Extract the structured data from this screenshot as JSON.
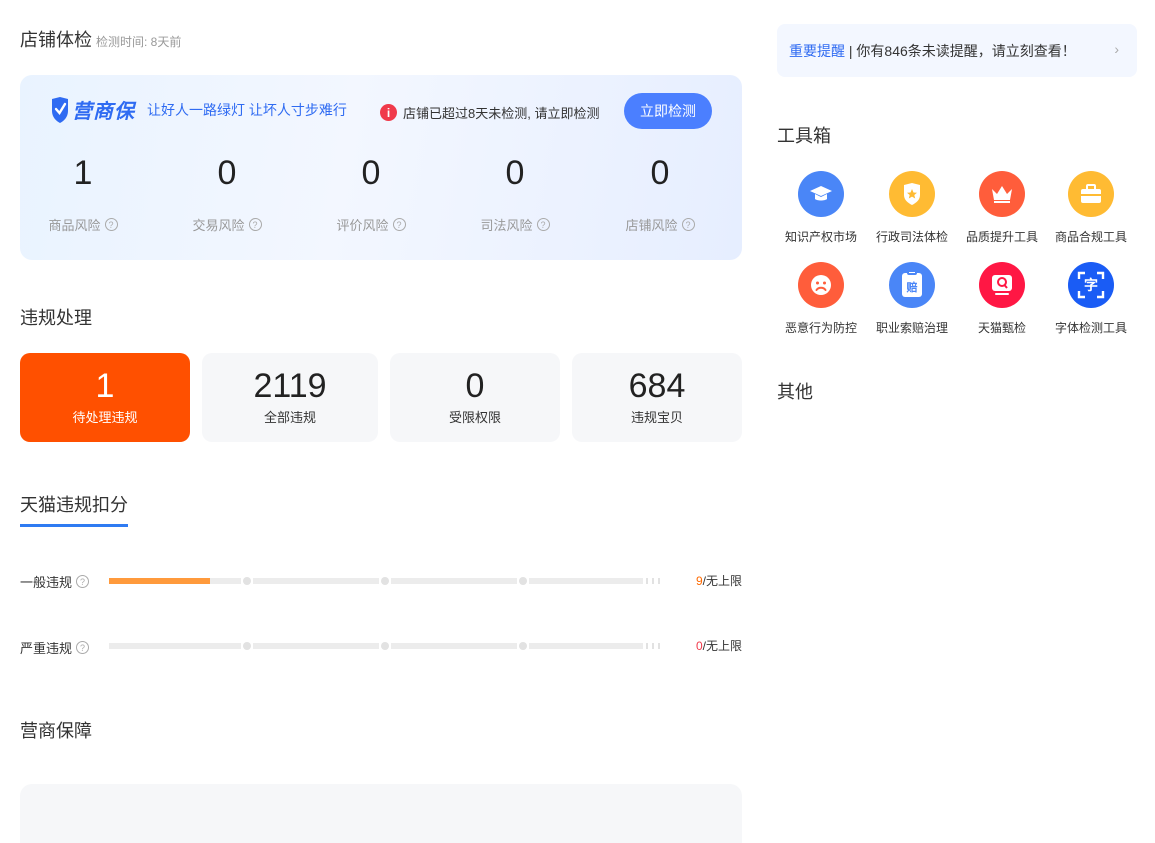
{
  "health": {
    "title": "店铺体检",
    "check_time": "检测时间: 8天前",
    "brand_name": "营商保",
    "slogan": "让好人一路绿灯 让坏人寸步难行",
    "warning": "店铺已超过8天未检测, 请立即检测",
    "detect_button": "立即检测",
    "risks": [
      {
        "value": "1",
        "label": "商品风险"
      },
      {
        "value": "0",
        "label": "交易风险"
      },
      {
        "value": "0",
        "label": "评价风险"
      },
      {
        "value": "0",
        "label": "司法风险"
      },
      {
        "value": "0",
        "label": "店铺风险"
      }
    ]
  },
  "violation": {
    "title": "违规处理",
    "stats": [
      {
        "value": "1",
        "label": "待处理违规"
      },
      {
        "value": "2119",
        "label": "全部违规"
      },
      {
        "value": "0",
        "label": "受限权限"
      },
      {
        "value": "684",
        "label": "违规宝贝"
      }
    ]
  },
  "tmall_deduction": {
    "tab": "天猫违规扣分",
    "rows": [
      {
        "label": "一般违规",
        "score": "9",
        "limit": "/无上限",
        "progress": 0.19
      },
      {
        "label": "严重违规",
        "score": "0",
        "limit": "/无上限",
        "progress": 0
      }
    ]
  },
  "guarantee": {
    "title": "营商保障"
  },
  "notice": {
    "link": "重要提醒",
    "separator": " | ",
    "text": "你有846条未读提醒，请立刻查看！"
  },
  "toolbox": {
    "title": "工具箱",
    "tools": [
      {
        "label": "知识产权市场",
        "icon": "graduation-cap-icon",
        "color": "#4a86f7"
      },
      {
        "label": "行政司法体检",
        "icon": "police-badge-icon",
        "color": "#ffbb33"
      },
      {
        "label": "品质提升工具",
        "icon": "crown-icon",
        "color": "#ff5d3b"
      },
      {
        "label": "商品合规工具",
        "icon": "briefcase-icon",
        "color": "#ffbb33"
      },
      {
        "label": "恶意行为防控",
        "icon": "sad-face-icon",
        "color": "#ff5d3b"
      },
      {
        "label": "职业索赔治理",
        "icon": "clipboard-icon",
        "color": "#4a86f7"
      },
      {
        "label": "天猫甄检",
        "icon": "tmall-inspect-icon",
        "color": "#ff1744"
      },
      {
        "label": "字体检测工具",
        "icon": "font-scan-icon",
        "color": "#1a5cf5"
      }
    ]
  },
  "other": {
    "title": "其他"
  },
  "icon_texts": {
    "clipboard": "赔",
    "font": "字"
  }
}
